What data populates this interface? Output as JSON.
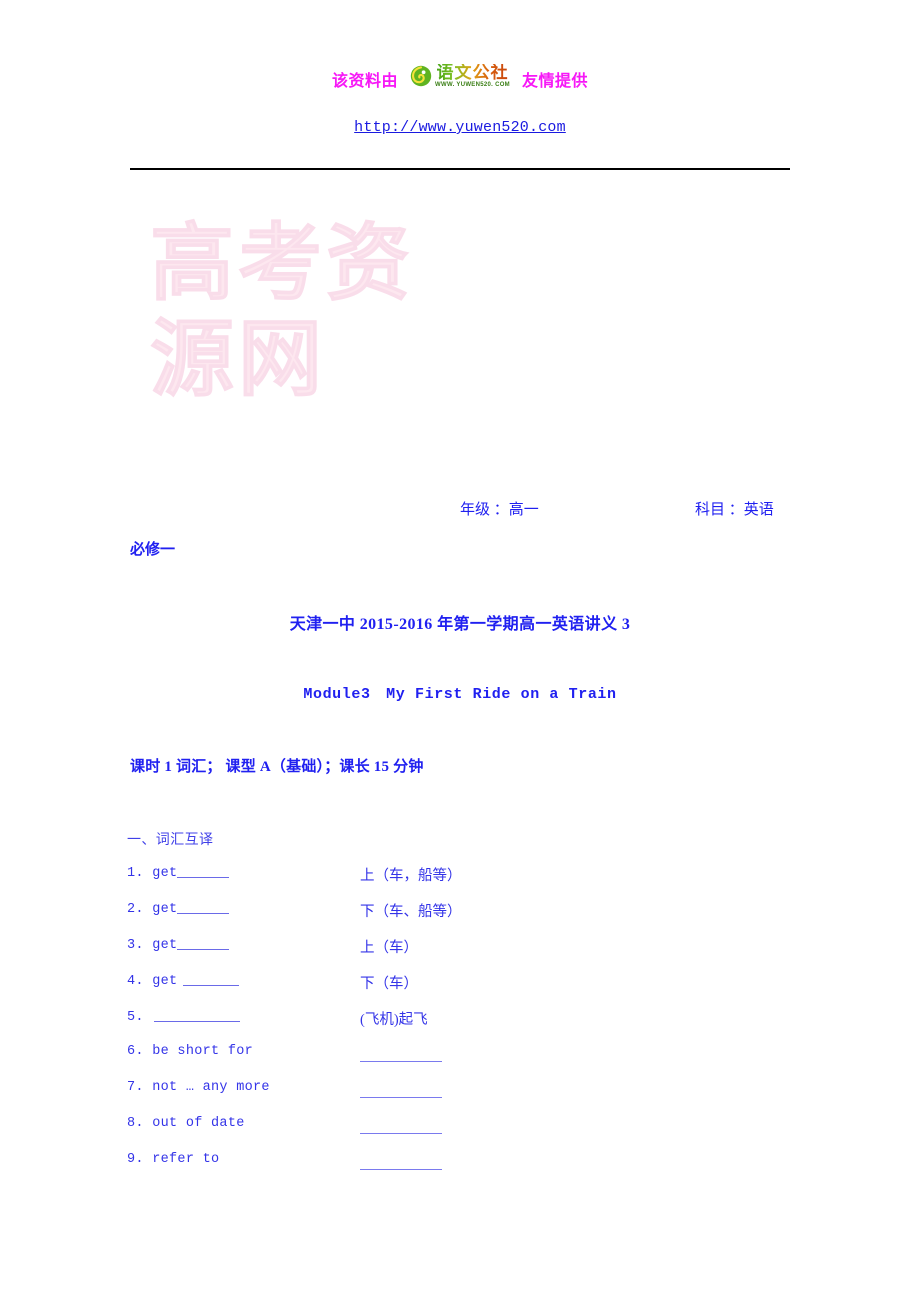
{
  "promo": {
    "prefix_text": "该资料由",
    "suffix_text": "友情提供",
    "logo": {
      "name_cn": "语文公社",
      "url_small": "WWW. YUWEN520. COM"
    },
    "site_url": "http://www.yuwen520.com"
  },
  "watermark": {
    "text": "高考资源网"
  },
  "meta": {
    "grade": "年级 ：高一",
    "subject": "科目 ：英语",
    "volume": "必修一"
  },
  "titles": {
    "doc_title": "天津一中 2015-2016 年第一学期高一英语讲义 3",
    "module_title": "Module3　My First Ride on a Train",
    "lesson_line": "课时 1 词汇； 课型 A（基础）；课长 15 分钟"
  },
  "section": {
    "heading": "一、词汇互译"
  },
  "vocab": {
    "items": [
      {
        "num": "1.",
        "term": "get",
        "blank_style": "term",
        "meaning": "上（车，船等）",
        "answer_blank": false
      },
      {
        "num": "2.",
        "term": "get",
        "blank_style": "term",
        "meaning": "下（车、船等）",
        "answer_blank": false
      },
      {
        "num": "3.",
        "term": "get",
        "blank_style": "term",
        "meaning": "上（车）",
        "answer_blank": false
      },
      {
        "num": "4.",
        "term": "get",
        "blank_style": "term-sp",
        "meaning": "下（车）",
        "answer_blank": false
      },
      {
        "num": "5.",
        "term": "",
        "blank_style": "term-long",
        "meaning": "(飞机)起飞",
        "answer_blank": false
      },
      {
        "num": "6.",
        "term": "be short for",
        "blank_style": "none",
        "meaning": "",
        "answer_blank": true
      },
      {
        "num": "7.",
        "term": "not … any more",
        "blank_style": "none",
        "meaning": "",
        "answer_blank": true
      },
      {
        "num": "8.",
        "term": "out of date",
        "blank_style": "none",
        "meaning": "",
        "answer_blank": true
      },
      {
        "num": "9.",
        "term": "refer to",
        "blank_style": "none",
        "meaning": "",
        "answer_blank": true
      }
    ]
  },
  "colors": {
    "promo_magenta": "#f718f7",
    "body_blue": "#2020f0",
    "link_blue": "#1a1ae0",
    "rule_black": "#000000",
    "watermark_pink": "#fdd9e6"
  }
}
